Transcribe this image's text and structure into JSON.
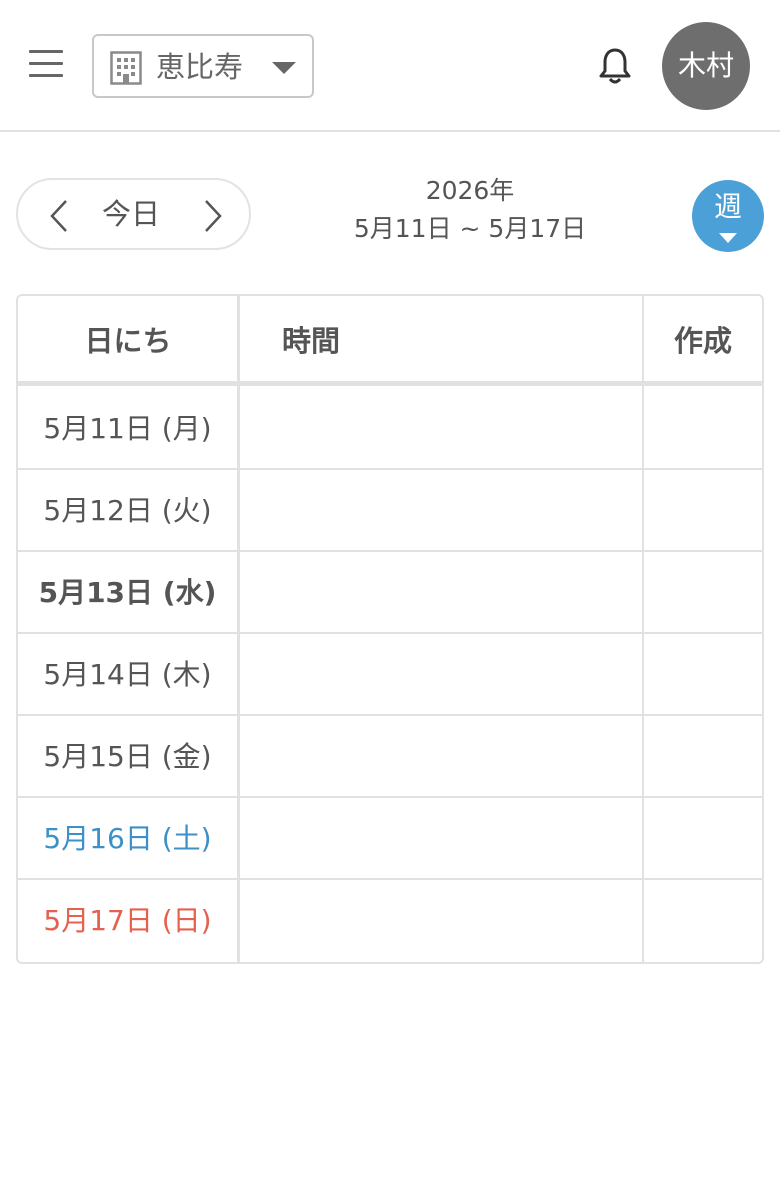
{
  "header": {
    "store_name": "恵比寿",
    "user_initials": "木村"
  },
  "nav": {
    "today_label": "今日",
    "year_label": "2026年",
    "range_label": "5月11日 ~ 5月17日",
    "view_label": "週"
  },
  "table": {
    "columns": [
      "日にち",
      "時間",
      "作成"
    ],
    "rows": [
      {
        "date": "5月11日 (月)"
      },
      {
        "date": "5月12日 (火)"
      },
      {
        "date": "5月13日 (水)"
      },
      {
        "date": "5月14日 (木)"
      },
      {
        "date": "5月15日 (金)"
      },
      {
        "date": "5月16日 (土)"
      },
      {
        "date": "5月17日 (日)"
      }
    ]
  },
  "colors": {
    "accent": "#4ba0d8",
    "saturday": "#3d8fc7",
    "sunday": "#e5604d",
    "avatar_bg": "#6e6e6e",
    "border": "#dfe2e5"
  },
  "icons": [
    "menu-icon",
    "building-icon",
    "chevron-down-icon",
    "bell-icon",
    "chevron-left-icon",
    "chevron-right-icon",
    "caret-down-icon"
  ]
}
